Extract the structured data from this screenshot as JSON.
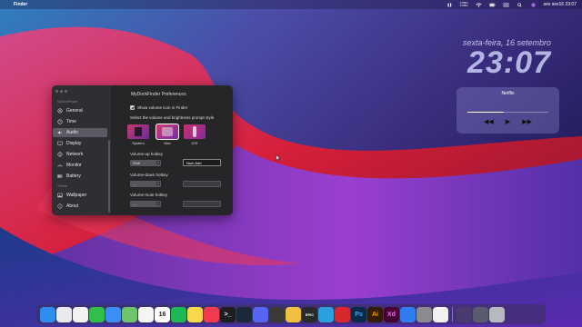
{
  "menubar": {
    "app_name": "Finder",
    "net_up": "0 KB/s",
    "net_down": "0 KB/s",
    "datetime": "sex sex16 23:07"
  },
  "desktop_widget": {
    "date": "sexta-feira, 16 setembro",
    "time": "23:07"
  },
  "music_widget": {
    "title": "Netflix",
    "progress": 0.45
  },
  "prefs_window": {
    "title": "MyDockFinder Preferences",
    "sidebar": {
      "section1": "MyDockFinder",
      "section2": "Theme",
      "items": [
        {
          "label": "General",
          "icon": "gear-icon"
        },
        {
          "label": "Time",
          "icon": "clock-icon"
        },
        {
          "label": "Audio",
          "icon": "speaker-icon",
          "active": true
        },
        {
          "label": "Display",
          "icon": "display-icon"
        },
        {
          "label": "Network",
          "icon": "globe-icon"
        },
        {
          "label": "Monitor",
          "icon": "gauge-icon"
        },
        {
          "label": "Battery",
          "icon": "battery-icon"
        },
        {
          "label": "Wallpaper",
          "icon": "picture-icon"
        },
        {
          "label": "About",
          "icon": "info-icon"
        }
      ]
    },
    "show_volume_label": "Show volume icon in Finder",
    "prompt_style_label": "Select the volume and brightness prompt style",
    "styles": [
      {
        "label": "System",
        "selected": false
      },
      {
        "label": "Mac",
        "selected": true
      },
      {
        "label": "IOS",
        "selected": false
      }
    ],
    "volume_up": {
      "label": "Volume-up hotkey",
      "modifier": "Shift",
      "key": "Num Add"
    },
    "volume_down": {
      "label": "Volume-down hotkey",
      "modifier": "--",
      "key": ""
    },
    "volume_mute": {
      "label": "Volume-mute hotkey",
      "modifier": "--",
      "key": ""
    }
  },
  "dock": {
    "apps": [
      {
        "name": "finder-icon",
        "color": "#2f8cf0",
        "glyph": ""
      },
      {
        "name": "launchpad-icon",
        "color": "#e9e9ef",
        "glyph": ""
      },
      {
        "name": "chrome-icon",
        "color": "#f2f2f2",
        "glyph": ""
      },
      {
        "name": "whatsapp-icon",
        "color": "#2fbf4a",
        "glyph": ""
      },
      {
        "name": "mail-icon",
        "color": "#3a8ef5",
        "glyph": ""
      },
      {
        "name": "maps-icon",
        "color": "#6fc36a",
        "glyph": ""
      },
      {
        "name": "photos-icon",
        "color": "#f5f5f5",
        "glyph": ""
      },
      {
        "name": "calendar-icon",
        "color": "#ffffff",
        "glyph": "16"
      },
      {
        "name": "spotify-icon",
        "color": "#1db954",
        "glyph": ""
      },
      {
        "name": "notes-icon",
        "color": "#f7d84a",
        "glyph": ""
      },
      {
        "name": "news-icon",
        "color": "#f53b4f",
        "glyph": ""
      },
      {
        "name": "terminal-icon",
        "color": "#1e1e1e",
        "glyph": ">_"
      },
      {
        "name": "steam-icon",
        "color": "#1b2838",
        "glyph": ""
      },
      {
        "name": "discord-icon",
        "color": "#5865f2",
        "glyph": ""
      },
      {
        "name": "calculator-icon",
        "color": "#3a3a3a",
        "glyph": ""
      },
      {
        "name": "explorer-icon",
        "color": "#f0c040",
        "glyph": ""
      },
      {
        "name": "epic-games-icon",
        "color": "#2a2a2a",
        "glyph": "EPIC"
      },
      {
        "name": "telegram-icon",
        "color": "#2ba0e0",
        "glyph": ""
      },
      {
        "name": "acrobat-icon",
        "color": "#d8282e",
        "glyph": ""
      },
      {
        "name": "photoshop-icon",
        "color": "#0b2a4a",
        "glyph": "Ps"
      },
      {
        "name": "illustrator-icon",
        "color": "#331c00",
        "glyph": "Ai"
      },
      {
        "name": "xd-icon",
        "color": "#470137",
        "glyph": "Xd"
      },
      {
        "name": "app-store-icon",
        "color": "#2f7df0",
        "glyph": ""
      },
      {
        "name": "settings-icon",
        "color": "#8a8a90",
        "glyph": ""
      },
      {
        "name": "safari-icon",
        "color": "#f2f2f2",
        "glyph": ""
      }
    ],
    "right": [
      {
        "name": "window-thumbnail-icon",
        "color": "#4a3a70",
        "glyph": ""
      },
      {
        "name": "downloads-icon",
        "color": "#5a5a70",
        "glyph": ""
      },
      {
        "name": "trash-icon",
        "color": "#b8b8c0",
        "glyph": ""
      }
    ]
  }
}
